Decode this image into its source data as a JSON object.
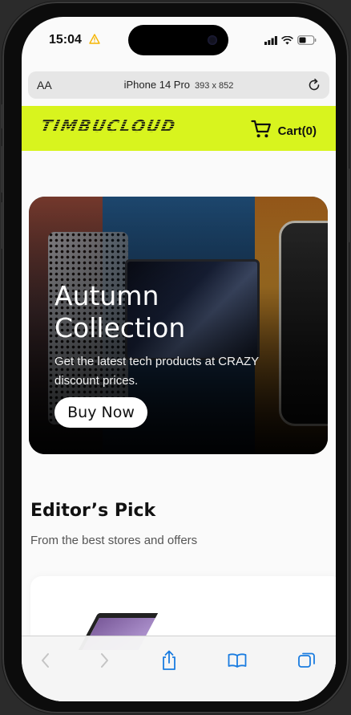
{
  "status_bar": {
    "time": "15:04"
  },
  "address_bar": {
    "text_size_label": "AA",
    "device_name": "iPhone 14 Pro",
    "device_dims": "393 x 852"
  },
  "header": {
    "logo": "TIMBUCLOUD",
    "cart_label": "Cart(0)"
  },
  "hero": {
    "title": "Autumn Collection",
    "subtitle": "Get the latest tech products at CRAZY discount prices.",
    "button_label": "Buy Now"
  },
  "editors_pick": {
    "title": "Editor’s Pick",
    "subtitle": "From the best stores and offers"
  },
  "icons": {
    "warning": "warning-icon",
    "signal": "signal-icon",
    "wifi": "wifi-icon",
    "battery": "battery-icon",
    "reload": "reload-icon",
    "cart": "cart-icon",
    "back": "chevron-left-icon",
    "forward": "chevron-right-icon",
    "share": "share-icon",
    "bookmarks": "book-icon",
    "tabs": "tabs-icon"
  },
  "colors": {
    "brand_accent": "#d8f41e",
    "toolbar_accent": "#1a7ce0",
    "warning": "#f5b400"
  }
}
